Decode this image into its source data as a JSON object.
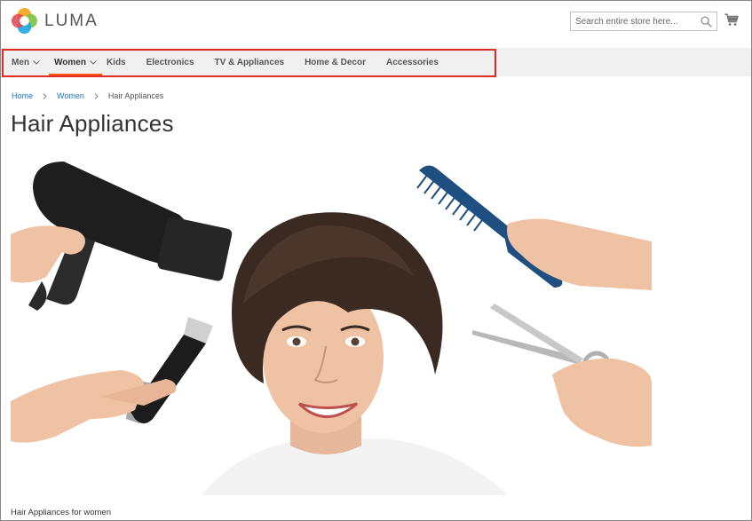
{
  "header": {
    "logo_text": "LUMA",
    "search_placeholder": "Search entire store here...",
    "icons": [
      "search-icon",
      "cart-icon"
    ]
  },
  "nav": {
    "items": [
      {
        "label": "Men",
        "has_dropdown": true
      },
      {
        "label": "Women",
        "has_dropdown": true,
        "active": true
      },
      {
        "label": "Kids",
        "has_dropdown": false
      },
      {
        "label": "Electronics",
        "has_dropdown": false
      },
      {
        "label": "TV & Appliances",
        "has_dropdown": false
      },
      {
        "label": "Home & Decor",
        "has_dropdown": false
      },
      {
        "label": "Accessories",
        "has_dropdown": false
      }
    ]
  },
  "breadcrumb": {
    "items": [
      "Home",
      "Women"
    ],
    "current": "Hair Appliances"
  },
  "page": {
    "title": "Hair Appliances",
    "description": "Hair Appliances for women"
  },
  "colors": {
    "link": "#1979c3",
    "nav_bg": "#f0f0f0",
    "active_underline": "#ff5501",
    "highlight_box": "#e02b27"
  }
}
